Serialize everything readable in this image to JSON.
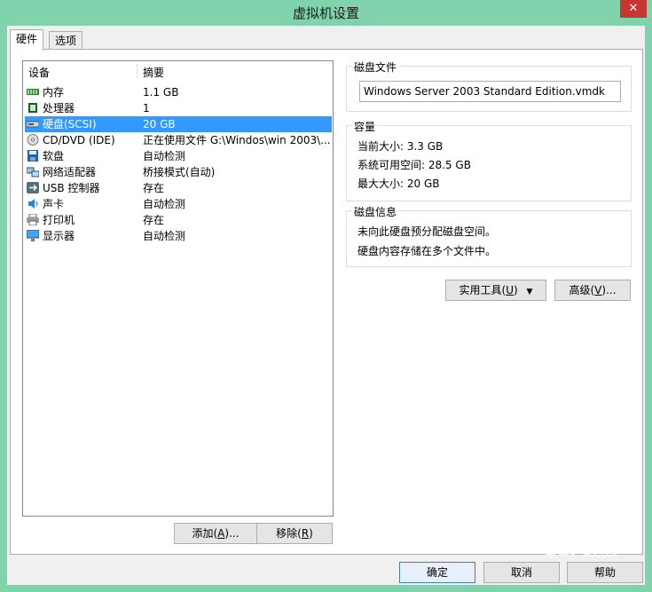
{
  "window": {
    "title": "虚拟机设置",
    "close_glyph": "✕"
  },
  "tabs": [
    {
      "label": "硬件"
    },
    {
      "label": "选项"
    }
  ],
  "device_list": {
    "headers": {
      "device": "设备",
      "summary": "摘要"
    },
    "items": [
      {
        "name": "内存",
        "summary": "1.1 GB",
        "icon": "memory-icon"
      },
      {
        "name": "处理器",
        "summary": "1",
        "icon": "processor-icon"
      },
      {
        "name": "硬盘(SCSI)",
        "summary": "20 GB",
        "icon": "hard-disk-icon",
        "selected": true
      },
      {
        "name": "CD/DVD (IDE)",
        "summary": "正在使用文件 G:\\Windos\\win 2003\\...",
        "icon": "cd-dvd-icon"
      },
      {
        "name": "软盘",
        "summary": "自动检测",
        "icon": "floppy-icon"
      },
      {
        "name": "网络适配器",
        "summary": "桥接模式(自动)",
        "icon": "network-adapter-icon"
      },
      {
        "name": "USB 控制器",
        "summary": "存在",
        "icon": "usb-icon"
      },
      {
        "name": "声卡",
        "summary": "自动检测",
        "icon": "sound-card-icon"
      },
      {
        "name": "打印机",
        "summary": "存在",
        "icon": "printer-icon"
      },
      {
        "name": "显示器",
        "summary": "自动检测",
        "icon": "display-icon"
      }
    ]
  },
  "device_buttons": {
    "add": {
      "label": "添加(",
      "key": "A",
      "suffix": ")..."
    },
    "remove": {
      "label": "移除(",
      "key": "R",
      "suffix": ")"
    }
  },
  "disk_file": {
    "label": "磁盘文件",
    "value": "Windows Server 2003 Standard Edition.vmdk"
  },
  "capacity": {
    "label": "容量",
    "current_size": "当前大小: 3.3 GB",
    "system_free": "系统可用空间: 28.5 GB",
    "max_size": "最大大小: 20 GB"
  },
  "disk_info": {
    "label": "磁盘信息",
    "line1": "未向此硬盘预分配磁盘空间。",
    "line2": "硬盘内容存储在多个文件中。"
  },
  "right_buttons": {
    "utilities": {
      "label": "实用工具(",
      "key": "U",
      "suffix": ")"
    },
    "advanced": {
      "label": "高级(",
      "key": "V",
      "suffix": ")..."
    }
  },
  "footer": {
    "ok": "确定",
    "cancel": "取消",
    "help": "帮助"
  },
  "watermark": "Bai 经验"
}
